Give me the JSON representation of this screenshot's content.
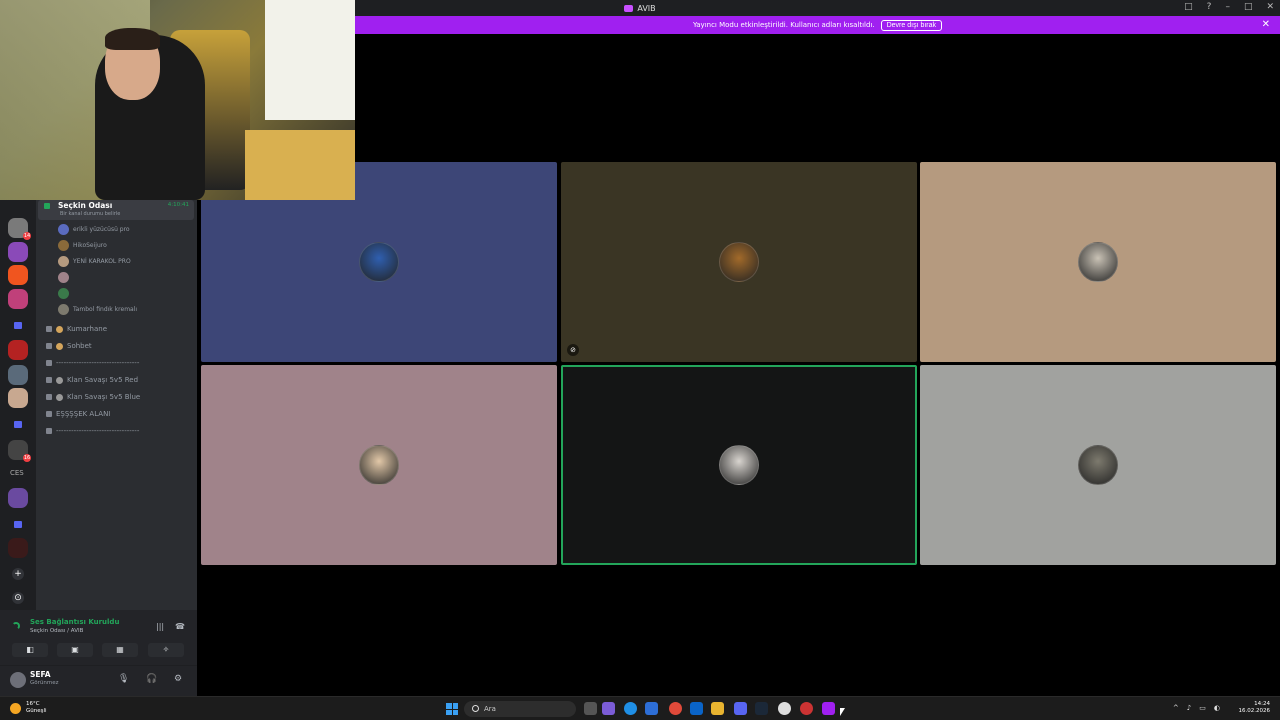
{
  "window": {
    "title": "AVIB",
    "controls": [
      "□",
      "?",
      "–",
      "□",
      "✕"
    ]
  },
  "banner": {
    "message": "Yayıncı Modu etkinleştirildi. Kullanıcı adları kısaltıldı.",
    "button": "Devre dışı bırak",
    "close": "✕"
  },
  "rail": {
    "text_server": "CES",
    "badge_1": "14",
    "badge_2": "16",
    "add_glyph": "+",
    "discover_glyph": "⊙"
  },
  "sidebar": {
    "active_channel": {
      "name": "Seçkin Odası",
      "subtitle": "Bir kanal durumu belirle",
      "timer": "4:10:41"
    },
    "members": [
      "erikli yüzücüsü pro",
      "HikoSeijuro",
      "YENİ KARAKOL PRO",
      "",
      "",
      "Tambol findık kremalı"
    ],
    "voice_channels": [
      "Kumarhane",
      "Sohbet",
      "---------------------------------",
      "Klan Savaşı 5v5 Red",
      "Klan Savaşı 5v5 Blue",
      "EŞŞŞŞEK ALANI",
      "---------------------------------"
    ]
  },
  "voice_panel": {
    "status": "Ses Bağlantısı Kuruldu",
    "channel": "Seçkin Odası / AVIB"
  },
  "user_panel": {
    "name": "SEFA",
    "status": "Görünmez"
  },
  "tiles": [
    {
      "color": "#3d4677",
      "avatar": "#2f5fb0",
      "speaking": false
    },
    {
      "color": "#3a3524",
      "avatar": "#a26a2a",
      "speaking": false,
      "flag": true
    },
    {
      "color": "#b59a7f",
      "avatar": "#c9c2b5",
      "speaking": false
    },
    {
      "color": "#a0838a",
      "avatar": "#e2c8a8",
      "speaking": false
    },
    {
      "color": "#141515",
      "avatar": "#d8d4cf",
      "speaking": true
    },
    {
      "color": "#a1a29f",
      "avatar": "#7d7a6e",
      "speaking": false
    }
  ],
  "taskbar": {
    "weather_temp": "16°C",
    "weather_desc": "Güneşli",
    "search_placeholder": "Ara",
    "time": "14:24",
    "date": "16.02.2026",
    "tray_icons": [
      "^",
      "♪",
      "▭",
      "◐"
    ]
  }
}
